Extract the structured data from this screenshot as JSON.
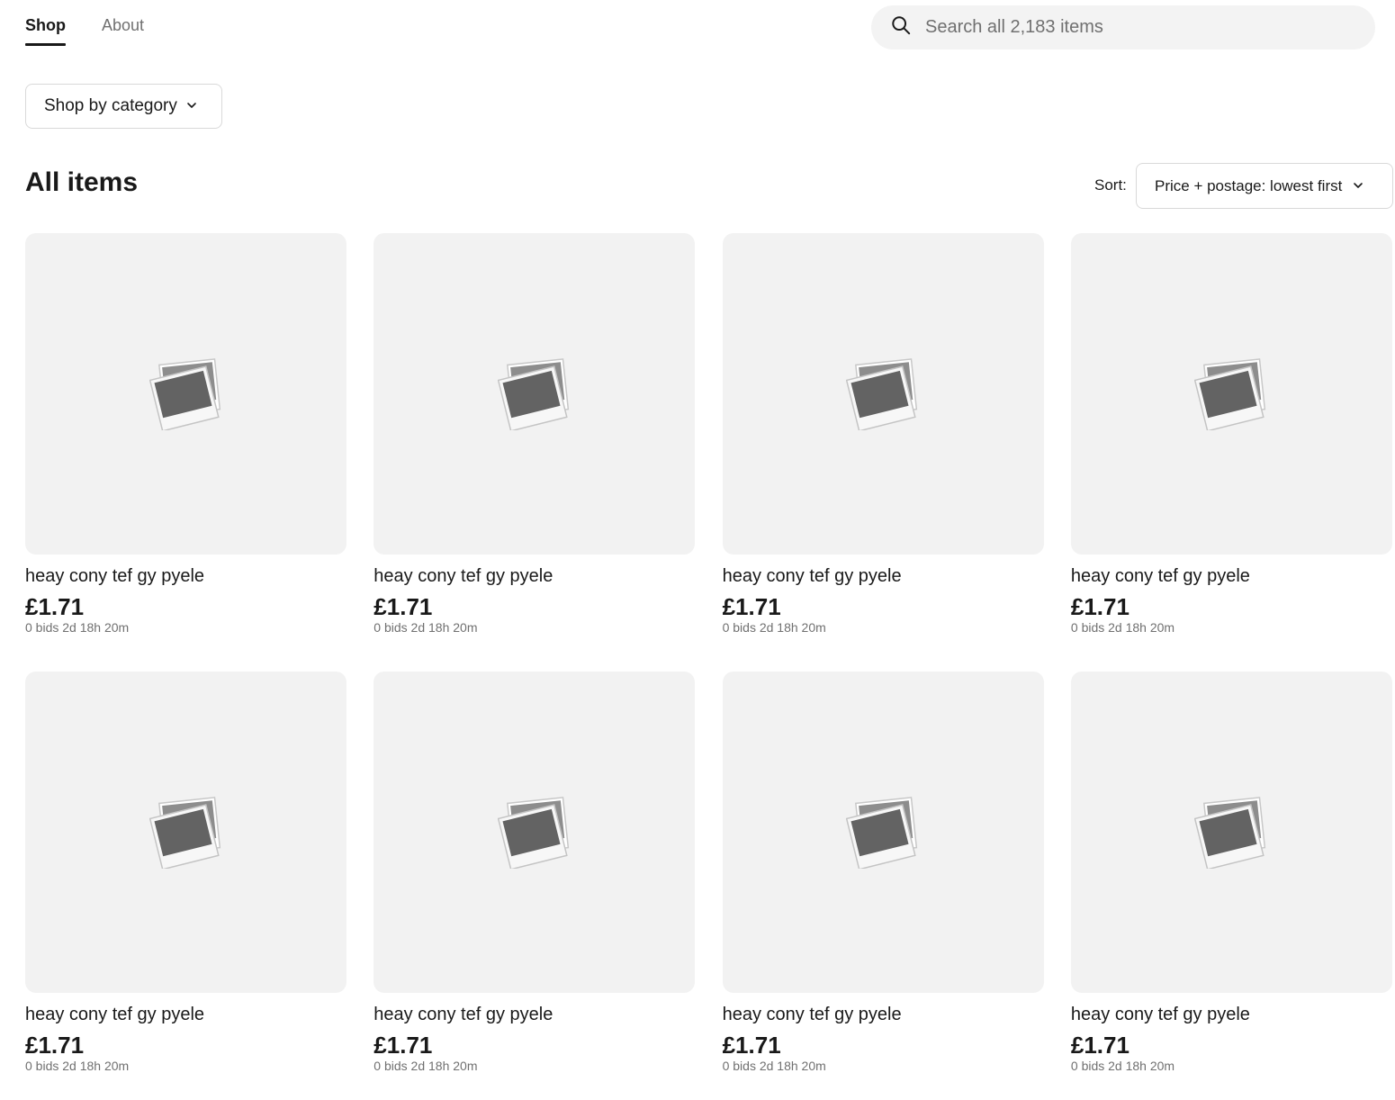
{
  "nav": {
    "tabs": [
      {
        "label": "Shop",
        "active": true
      },
      {
        "label": "About",
        "active": false
      }
    ]
  },
  "search": {
    "icon": "search-icon",
    "placeholder": "Search all 2,183 items",
    "value": ""
  },
  "filters": {
    "category_label": "Shop by category"
  },
  "listing": {
    "heading": "All items",
    "sort_label": "Sort:",
    "sort_value": "Price + postage: lowest first"
  },
  "items": [
    {
      "title": "heay cony tef gy pyele",
      "price": "£1.71",
      "meta": "0 bids 2d 18h 20m"
    },
    {
      "title": "heay cony tef gy pyele",
      "price": "£1.71",
      "meta": "0 bids 2d 18h 20m"
    },
    {
      "title": "heay cony tef gy pyele",
      "price": "£1.71",
      "meta": "0 bids 2d 18h 20m"
    },
    {
      "title": "heay cony tef gy pyele",
      "price": "£1.71",
      "meta": "0 bids 2d 18h 20m"
    },
    {
      "title": "heay cony tef gy pyele",
      "price": "£1.71",
      "meta": "0 bids 2d 18h 20m"
    },
    {
      "title": "heay cony tef gy pyele",
      "price": "£1.71",
      "meta": "0 bids 2d 18h 20m"
    },
    {
      "title": "heay cony tef gy pyele",
      "price": "£1.71",
      "meta": "0 bids 2d 18h 20m"
    },
    {
      "title": "heay cony tef gy pyele",
      "price": "£1.71",
      "meta": "0 bids 2d 18h 20m"
    }
  ],
  "colors": {
    "text": "#191919",
    "muted": "#707070",
    "placeholder_bg": "#f2f2f2",
    "border": "#d9d9d9"
  }
}
